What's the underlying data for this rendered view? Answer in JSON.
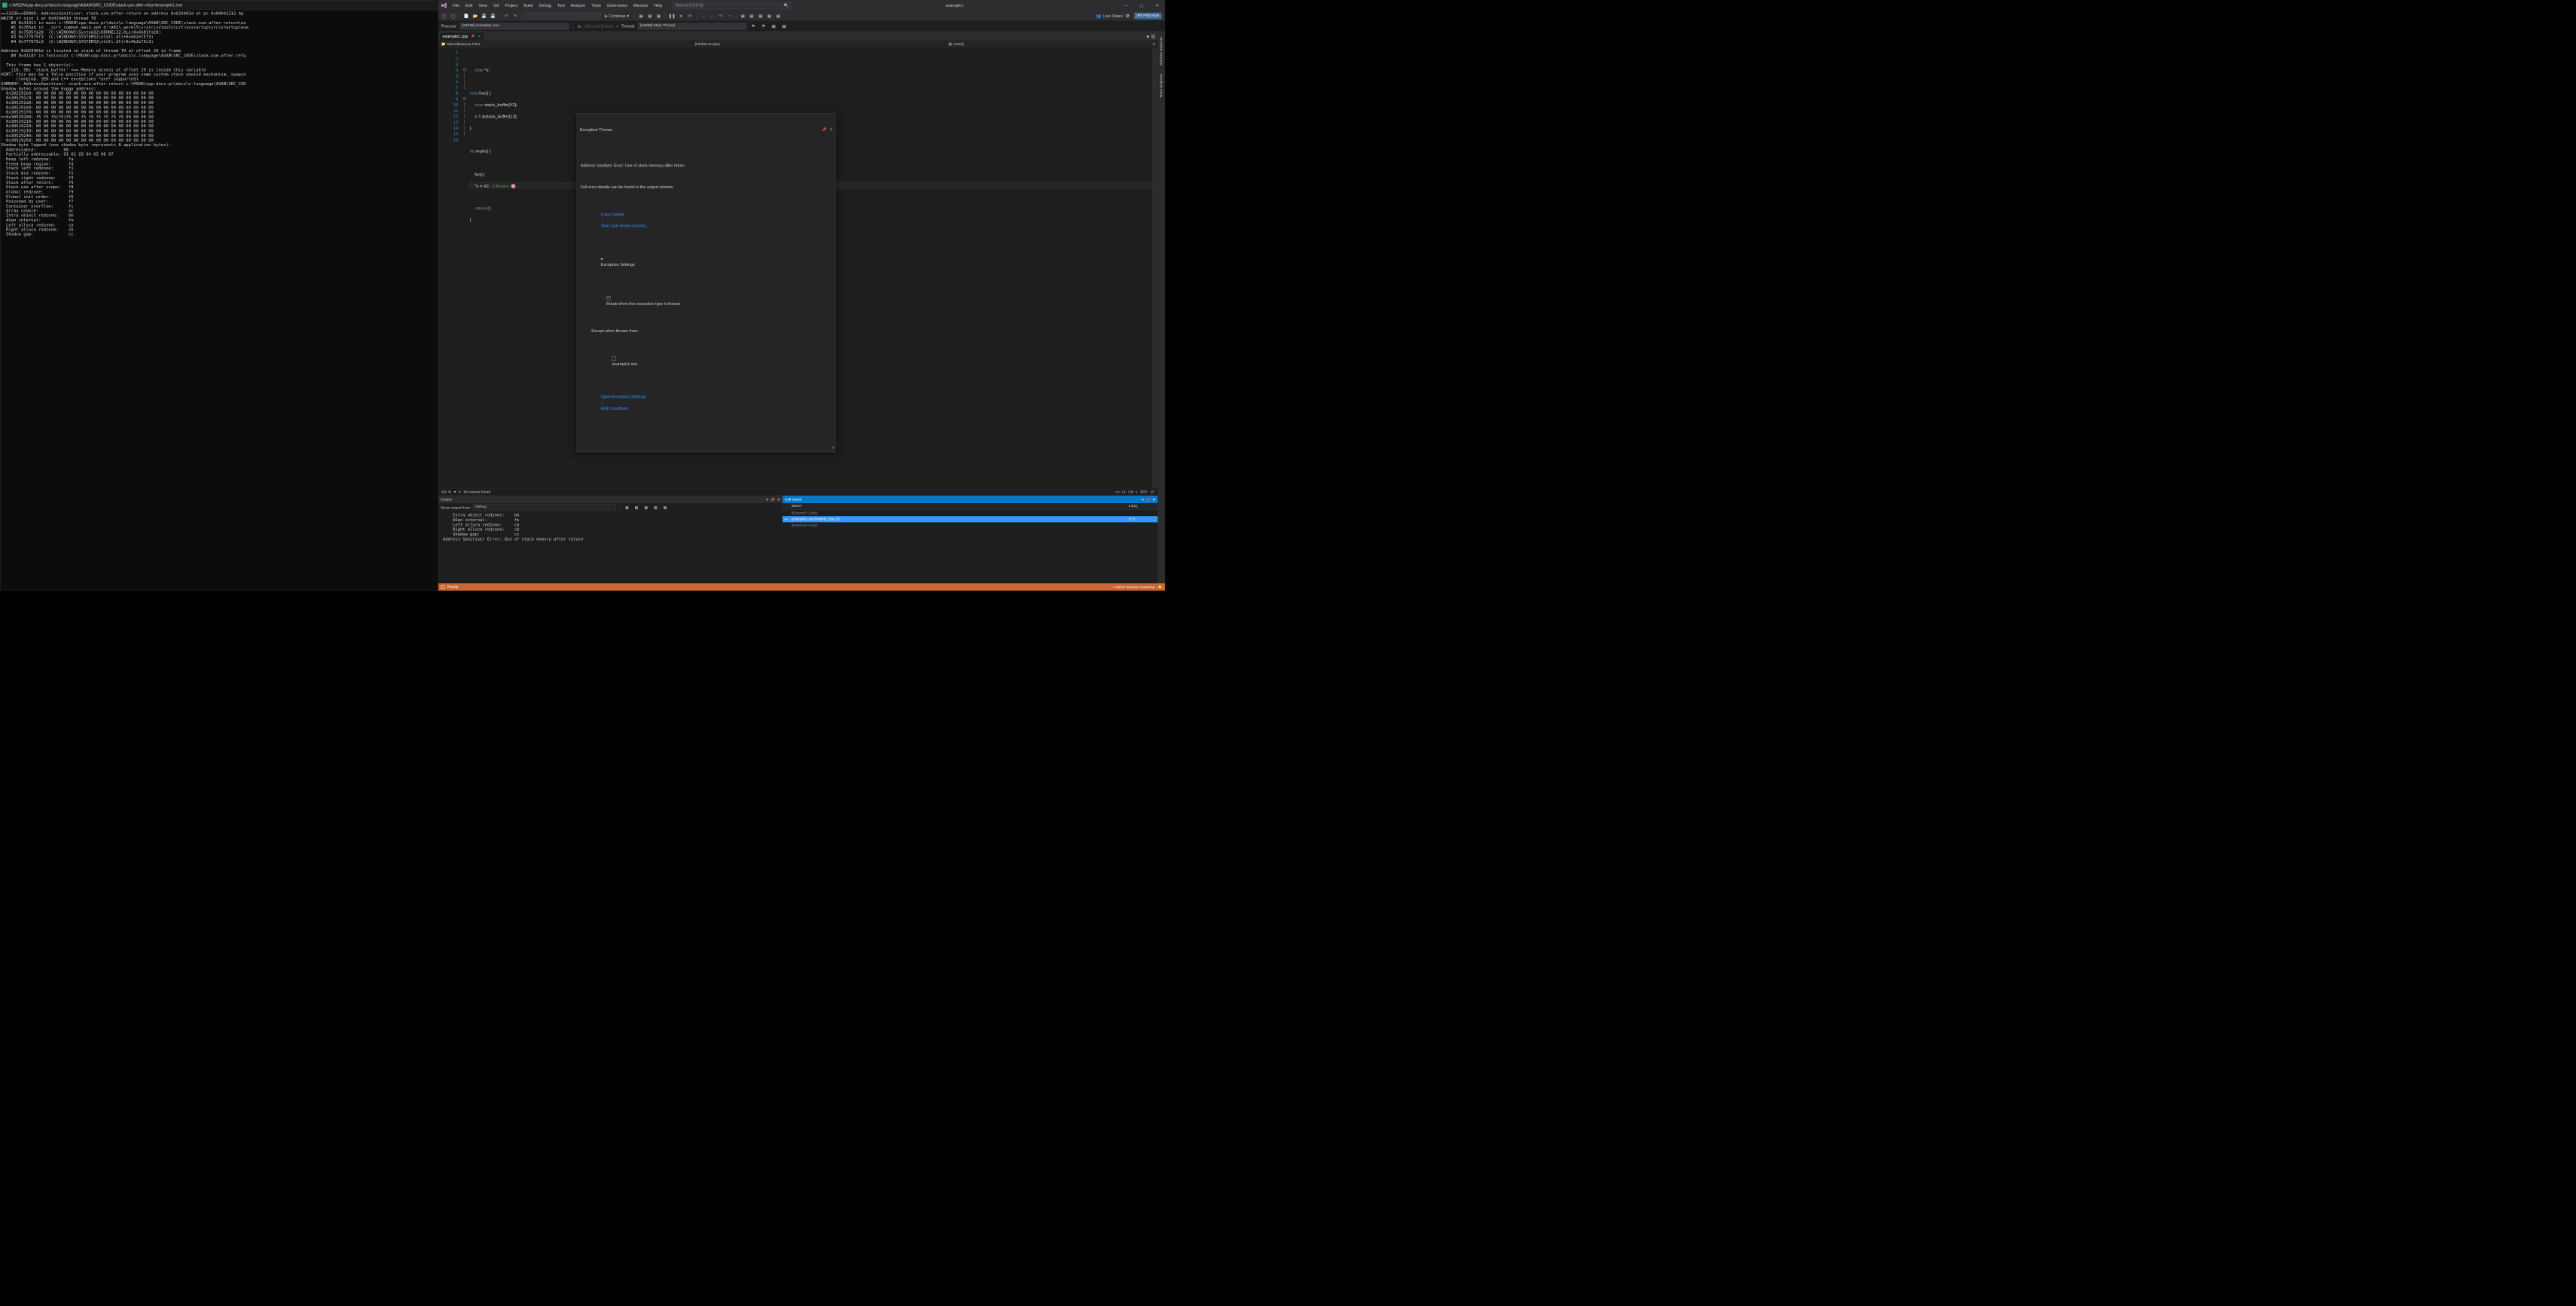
{
  "console": {
    "title_text": "c:\\MSDN\\cpp-docs-pr\\docs\\c-language\\ASAN\\SRC_CODE\\stack-use-after-return\\example1.exe",
    "body": "==33336==ERROR: AddressSanitizer: stack-use-after-return on address 0x029401d at pc 0x00041312 bp\nWRITE of size 1 at 0x029401d thread T0\n    #0 0x41311 in main c:\\MSDN\\cpp-docs-pr\\docs\\c-language\\ASAN\\SRC_CODE\\stack-use-after-return\\ex\n    #1 0x785ab in __scrt_common_main_seh d:\\A01\\_work\\5\\s\\src\\vctools\\crt\\vcstartup\\src\\startup\\exe\n    #2 0x7585fa28  (C:\\WINDOWS\\System32\\KERNEL32.DLL+0x6b81fa28)\n    #3 0x777075f3  (C:\\WINDOWS\\SYSTEM32\\ntdll.dll+0x4b2e75f3)\n    #4 0x777075c3  (C:\\WINDOWS\\SYSTEM32\\ntdll.dll+0x4b2e75c3)\n\nAddress 0x029401d is located in stack of thread T0 at offset 29 in frame\n    #0 0x4118f in foo(void) c:\\MSDN\\cpp-docs-pr\\docs\\c-language\\ASAN\\SRC_CODE\\stack-use-after-retu\n\n  This frame has 1 object(s):\n    [16, 58) 'stack_buffer' <== Memory access at offset 29 is inside this variable\nHINT: this may be a false positive if your program uses some custom stack unwind mechanism, swapco\n      (longjmp, SEH and C++ exceptions *are* supported)\nSUMMARY: AddressSanitizer: stack-use-after-return c:\\MSDN\\cpp-docs-pr\\docs\\c-language\\ASAN\\SRC_COD\nShadow bytes around the buggy address:\n  0x305291b0: 00 00 00 00 00 00 00 00 00 00 00 00 00 00 00 00\n  0x305291c0: 00 00 00 00 00 00 00 00 00 00 00 00 00 00 00 00\n  0x305291d0: 00 00 00 00 00 00 00 00 00 00 00 00 00 00 00 00\n  0x305291e0: 00 00 00 00 00 00 00 00 00 00 00 00 00 00 00 00\n  0x305291f0: 00 00 00 00 00 00 00 00 00 00 00 00 00 00 00 00\n=>0x30529200: f5 f5 f5[f5]f5 f5 f5 f5 f5 f5 f5 f5 00 00 00 00\n  0x30529210: 00 00 00 00 00 00 00 00 00 00 00 00 00 00 00 00\n  0x30529220: 00 00 00 00 00 00 00 00 00 00 00 00 00 00 00 00\n  0x30529230: 00 00 00 00 00 00 00 00 00 00 00 00 00 00 00 00\n  0x30529240: 00 00 00 00 00 00 00 00 00 00 00 00 00 00 00 00\n  0x30529250: 00 00 00 00 00 00 00 00 00 00 00 00 00 00 00 00\nShadow byte legend (one shadow byte represents 8 application bytes):\n  Addressable:           00\n  Partially addressable: 01 02 03 04 05 06 07\n  Heap left redzone:       fa\n  Freed heap region:       fd\n  Stack left redzone:      f1\n  Stack mid redzone:       f2\n  Stack right redzone:     f3\n  Stack after return:      f5\n  Stack use after scope:   f8\n  Global redzone:          f9\n  Global init order:       f6\n  Poisoned by user:        f7\n  Container overflow:      fc\n  Array cookie:            ac\n  Intra object redzone:    bb\n  ASan internal:           fe\n  Left alloca redzone:     ca\n  Right alloca redzone:    cb\n  Shadow gap:              cc"
  },
  "vs": {
    "menu": [
      "File",
      "Edit",
      "View",
      "Git",
      "Project",
      "Build",
      "Debug",
      "Test",
      "Analyze",
      "Tools",
      "Extensions",
      "Window",
      "Help"
    ],
    "search_placeholder": "Search (Ctrl+Q)",
    "title": "example1",
    "int_preview": "INT PREVIEW",
    "continue_label": "Continue",
    "live_share": "Live Share",
    "process_label": "Process:",
    "process_value": "[33336] example1.exe",
    "lifecycle_label": "Lifecycle Events",
    "thread_label": "Thread:",
    "thread_value": "[24608] Main Thread",
    "tab_name": "example1.cpp",
    "nav1": "Miscellaneous Files",
    "nav2": "(Global Scope)",
    "nav3": "main()",
    "gutter_lines": [
      "1",
      "2",
      "3",
      "4",
      "5",
      "6",
      "7",
      "8",
      "9",
      "10",
      "11",
      "12",
      "13",
      "14",
      "15",
      "16"
    ],
    "code": {
      "l2a": "char",
      "l2b": " *x;",
      "l4a": "void",
      "l4b": " foo",
      "l4c": "() {",
      "l5a": "char",
      "l5b": " stack_buffer[",
      "l5c": "42",
      "l5d": "];",
      "l6a": "x = &stack_buffer[",
      "l6b": "13",
      "l6c": "];",
      "l7": "}",
      "l9a": "int",
      "l9b": " main",
      "l9c": "() {",
      "l11a": "foo",
      "l11b": "();",
      "l12a": "*x = ",
      "l12b": "42",
      "l12c": ";  ",
      "l12d": "// Boom!",
      "l14a": "return",
      "l14b": " ",
      "l14c": "0",
      "l14d": ";",
      "l15": "}"
    },
    "info": {
      "zoom": "111 %",
      "issues": "No issues found",
      "ln": "Ln: 12",
      "ch": "Ch: 1",
      "spc": "SPC",
      "lf": "LF"
    },
    "exception": {
      "title": "Exception Thrown",
      "msg": "Address Sanitizer Error: Use of stack memory after return",
      "detail": "Full error details can be found in the output window",
      "copy": "Copy Details",
      "start_live": "Start Live Share session...",
      "settings_hdr": "Exception Settings",
      "break_label": "Break when this exception type is thrown",
      "except_label": "Except when thrown from:",
      "ex_module": "example1.exe",
      "open_settings": "Open Exception Settings",
      "edit_cond": "Edit Conditions"
    },
    "output": {
      "title": "Output",
      "show_label": "Show output from:",
      "show_value": "Debug",
      "body": "     Intra object redzone:    bb\n     ASan internal:           fe\n     Left alloca redzone:     ca\n     Right alloca redzone:    cb\n     Shadow gap:              cc\n Address Sanitizer Error: Use of stack memory after return\n "
    },
    "callstack": {
      "title": "Call Stack",
      "col_name": "Name",
      "col_lang": "Lang",
      "row1": "[External Code]",
      "row2": "example1.exe!main() Line 12",
      "row2_lang": "C++",
      "row3": "[External Code]"
    },
    "status": {
      "ready": "Ready",
      "add_src": "Add to Source Control"
    }
  }
}
